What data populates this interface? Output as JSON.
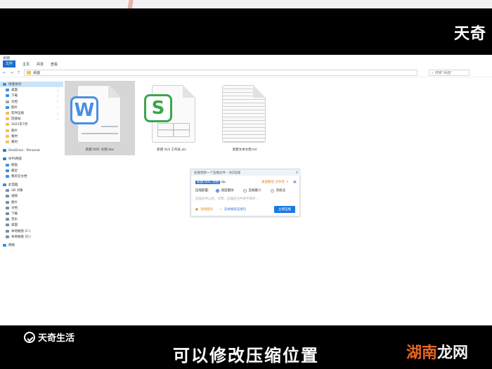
{
  "top_logo": "天奇",
  "explorer": {
    "title": "桌面",
    "menu": {
      "file": "文件",
      "home": "主页",
      "share": "共享",
      "view": "查看"
    },
    "address": "桌面",
    "search_placeholder": "搜索\"桌面\""
  },
  "sidebar": {
    "quick_access": "快速访问",
    "items": [
      {
        "label": "桌面",
        "color": "#3b8ee0"
      },
      {
        "label": "下载",
        "color": "#3b8ee0"
      },
      {
        "label": "文档",
        "color": "#9aa3ad"
      },
      {
        "label": "图片",
        "color": "#3b8ee0"
      },
      {
        "label": "软件压缩",
        "color": "#f3c24d"
      },
      {
        "label": "回收站",
        "color": "#f3c24d"
      },
      {
        "label": "2021年7月",
        "color": "#f3c24d"
      },
      {
        "label": "图片",
        "color": "#f3c24d"
      },
      {
        "label": "素材",
        "color": "#f3c24d"
      },
      {
        "label": "素材",
        "color": "#f3c24d"
      }
    ],
    "onedrive": "OneDrive - Personal",
    "wps": "WPS网盘",
    "wps_items": [
      "网盘",
      "最近",
      "我的云文档"
    ],
    "this_pc": "此电脑",
    "pc_items": [
      "3D 对象",
      "视频",
      "图片",
      "文档",
      "下载",
      "音乐",
      "桌面",
      "本地磁盘 (C:)",
      "本地磁盘 (D:)"
    ],
    "network": "网络"
  },
  "files": [
    {
      "name": "新建 DOC 文档.doc",
      "icon": "wps-writer-icon",
      "letter": "W",
      "color": "#4a8fe0"
    },
    {
      "name": "新建 XLS 工作表.xls",
      "icon": "wps-spreadsheet-icon",
      "letter": "S",
      "color": "#3aa64b"
    },
    {
      "name": "新建文本文档.txt",
      "icon": "text-document-icon"
    }
  ],
  "dialog": {
    "title": "压缩到新一个压缩文件 - WZ压缩",
    "filename_selected": "新建 DOC 文档",
    "filename_rest": ".zip",
    "location": "桌面路径 文件夹",
    "mode_label": "压缩配置:",
    "options": [
      "速度最快",
      "压缩最小",
      "添加注"
    ],
    "note": "压缩文件以后，可用，压缩后文件将不保存...",
    "links": [
      "添加密码",
      "去掉搜索压缩包"
    ],
    "start_button": "立即压缩"
  },
  "brand": "天奇生活",
  "subtitle": "可以修改压缩位置",
  "watermark": {
    "part1": "湖南",
    "part2": "龙网"
  }
}
